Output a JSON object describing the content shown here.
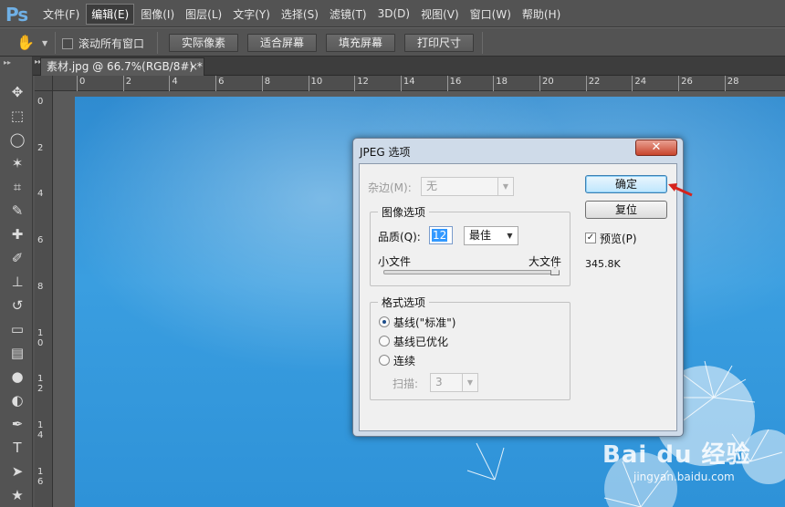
{
  "app": {
    "logo": "Ps",
    "menu": [
      "文件(F)",
      "编辑(E)",
      "图像(I)",
      "图层(L)",
      "文字(Y)",
      "选择(S)",
      "滤镜(T)",
      "3D(D)",
      "视图(V)",
      "窗口(W)",
      "帮助(H)"
    ],
    "active_menu_index": 1
  },
  "options_bar": {
    "scroll_all_label": "滚动所有窗口",
    "scroll_all_checked": false,
    "buttons": [
      "实际像素",
      "适合屏幕",
      "填充屏幕",
      "打印尺寸"
    ]
  },
  "document": {
    "tab_title": "素材.jpg @ 66.7%(RGB/8#) *",
    "close_glyph": "×"
  },
  "rulers": {
    "horizontal": [
      "0",
      "2",
      "4",
      "6",
      "8",
      "10",
      "12",
      "14",
      "16",
      "18",
      "20",
      "22",
      "24",
      "26",
      "28"
    ],
    "vertical": [
      "0",
      "2",
      "4",
      "6",
      "8",
      "10",
      "12",
      "14",
      "16"
    ]
  },
  "tools": [
    "move-icon",
    "marquee-icon",
    "lasso-icon",
    "magic-wand-icon",
    "crop-icon",
    "eyedropper-icon",
    "healing-icon",
    "brush-icon",
    "stamp-icon",
    "history-brush-icon",
    "eraser-icon",
    "gradient-icon",
    "blur-icon",
    "dodge-icon",
    "pen-icon",
    "type-icon",
    "path-select-icon",
    "shape-icon"
  ],
  "dialog": {
    "title": "JPEG 选项",
    "close_glyph": "✕",
    "matte_label": "杂边(M):",
    "matte_value": "无",
    "image_options_title": "图像选项",
    "quality_label": "品质(Q):",
    "quality_value": "12",
    "quality_preset": "最佳",
    "small_file_label": "小文件",
    "large_file_label": "大文件",
    "quality_slider_fraction": 1.0,
    "format_options_title": "格式选项",
    "format_options": [
      "基线(\"标准\")",
      "基线已优化",
      "连续"
    ],
    "selected_format_index": 0,
    "scans_label": "扫描:",
    "scans_value": "3",
    "ok_button": "确定",
    "reset_button": "复位",
    "preview_label": "预览(P)",
    "preview_checked": true,
    "file_size": "345.8K"
  },
  "watermark": {
    "brand": "Bai du 经验",
    "url": "jingyan.baidu.com"
  },
  "colors": {
    "workspace": "#535353",
    "sky": "#2f8bd0",
    "dialog_frame": "#cfdbe9",
    "close_button": "#c8452d",
    "arrow": "#d6231c"
  }
}
